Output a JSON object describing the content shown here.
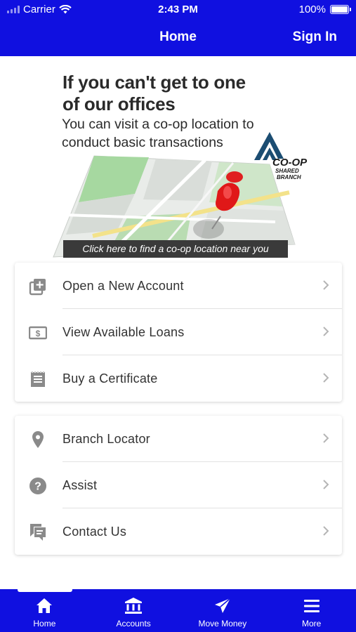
{
  "status_bar": {
    "carrier": "Carrier",
    "time": "2:43 PM",
    "battery": "100%"
  },
  "header": {
    "title": "Home",
    "sign_in": "Sign In"
  },
  "banner": {
    "headline_line1": "If you can't get to one",
    "headline_line2": "of our offices",
    "subtext_line1": "You can visit a co-op location to",
    "subtext_line2": "conduct basic transactions",
    "logo_text1": "CO-OP",
    "logo_text2": "SHARED",
    "logo_text3": "BRANCH",
    "cta": "Click here to find a co-op location near you"
  },
  "menu_group_1": [
    {
      "label": "Open a New Account",
      "icon": "add-box-icon"
    },
    {
      "label": "View Available Loans",
      "icon": "dollar-bill-icon"
    },
    {
      "label": "Buy a Certificate",
      "icon": "certificate-icon"
    }
  ],
  "menu_group_2": [
    {
      "label": "Branch Locator",
      "icon": "map-pin-icon"
    },
    {
      "label": "Assist",
      "icon": "help-circle-icon"
    },
    {
      "label": "Contact Us",
      "icon": "chat-icon"
    }
  ],
  "tab_bar": [
    {
      "label": "Home",
      "icon": "home-icon"
    },
    {
      "label": "Accounts",
      "icon": "bank-icon"
    },
    {
      "label": "Move Money",
      "icon": "send-icon"
    },
    {
      "label": "More",
      "icon": "menu-icon"
    }
  ],
  "colors": {
    "brand_blue": "#1010e0",
    "icon_gray": "#8a8a8a",
    "text_dark": "#333333"
  }
}
